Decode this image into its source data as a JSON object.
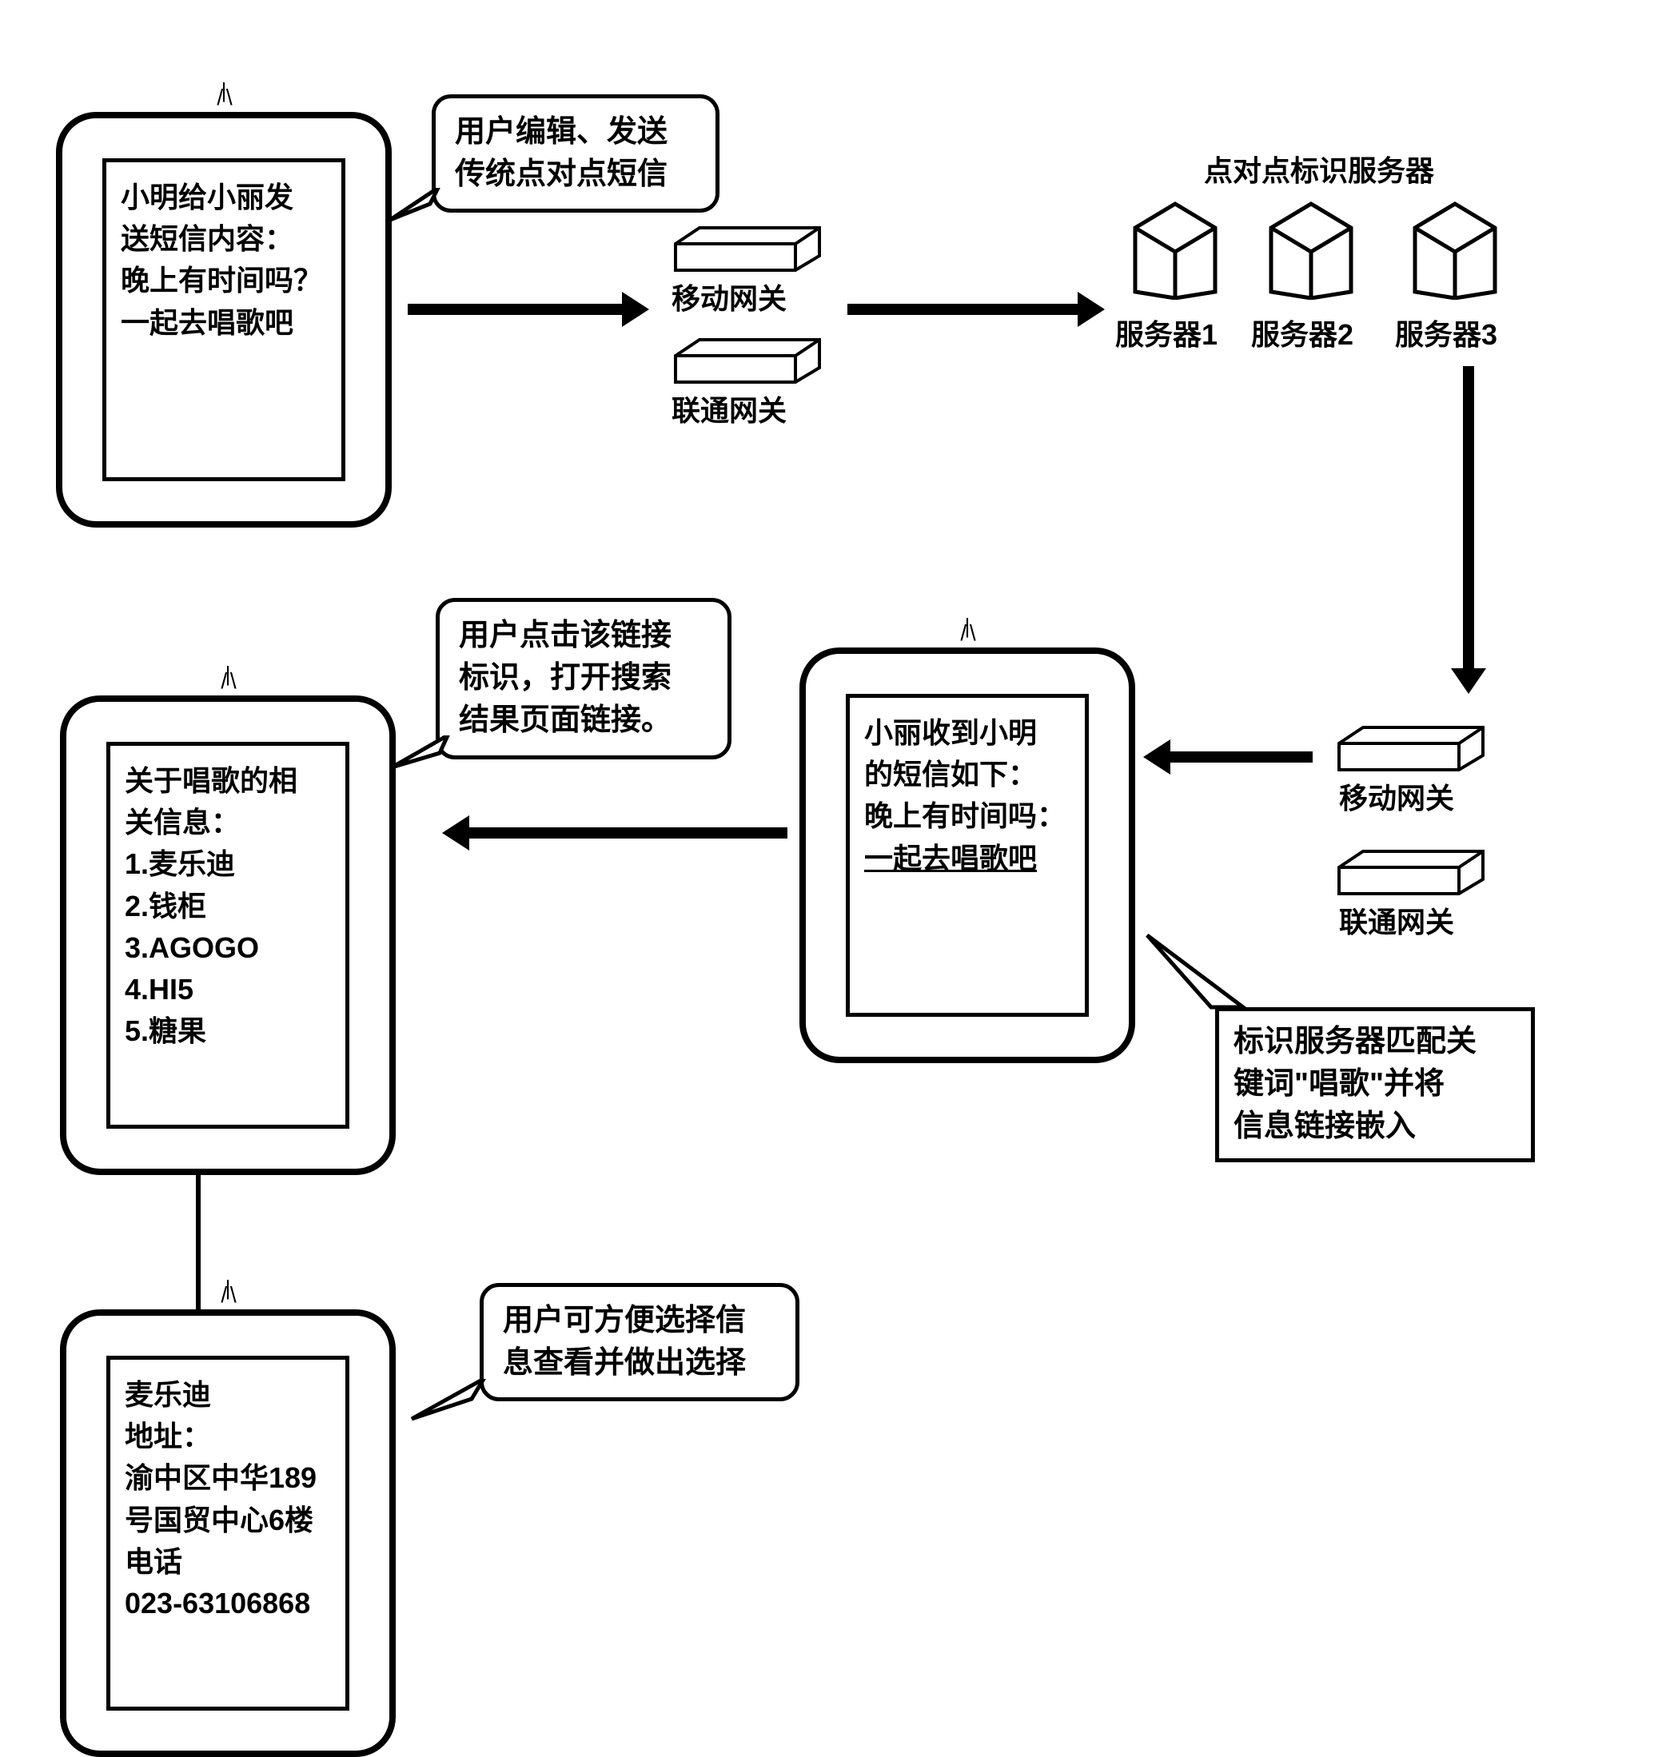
{
  "phone1": {
    "line1": "小明给小丽发",
    "line2": "送短信内容：",
    "line3": "晚上有时间吗？",
    "line4": "一起去唱歌吧"
  },
  "bubble1": {
    "line1": "用户编辑、发送",
    "line2": "传统点对点短信"
  },
  "gateway1": "移动网关",
  "gateway2": "联通网关",
  "servers_title": "点对点标识服务器",
  "server1": "服务器1",
  "server2": "服务器2",
  "server3": "服务器3",
  "gateway3": "移动网关",
  "gateway4": "联通网关",
  "note1": {
    "line1": "标识服务器匹配关",
    "line2": "键词\"唱歌\"并将",
    "line3": "信息链接嵌入"
  },
  "phone2": {
    "line1": "小丽收到小明",
    "line2": "的短信如下：",
    "line3": "晚上有时间吗：",
    "line4": "一起去唱歌吧"
  },
  "bubble2": {
    "line1": "用户点击该链接",
    "line2": "标识，打开搜索",
    "line3": "结果页面链接。"
  },
  "phone3": {
    "line1": "关于唱歌的相",
    "line2": "关信息：",
    "item1": "1.麦乐迪",
    "item2": "2.钱柜",
    "item3": "3.AGOGO",
    "item4": "4.HI5",
    "item5": "5.糖果"
  },
  "bubble3": {
    "line1": "用户可方便选择信",
    "line2": "息查看并做出选择"
  },
  "phone4": {
    "line1": "麦乐迪",
    "line2": "地址：",
    "line3": "渝中区中华189",
    "line4": "号国贸中心6楼",
    "line5": "电话",
    "line6": "023-63106868"
  }
}
